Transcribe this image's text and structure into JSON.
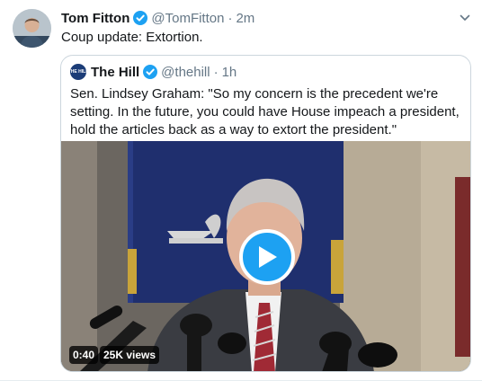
{
  "tweet": {
    "author_name": "Tom Fitton",
    "author_handle": "@TomFitton",
    "separator": "·",
    "timestamp": "2m",
    "text": "Coup update: Extortion."
  },
  "quoted_tweet": {
    "avatar_text": "THE HILL",
    "author_name": "The Hill",
    "author_handle": "@thehill",
    "separator": "·",
    "timestamp": "1h",
    "text": "Sen. Lindsey Graham: \"So my concern is the precedent we're setting. In the future, you could have House impeach a president, hold the articles back as a way to extort the president.\"",
    "video": {
      "duration": "0:40",
      "views": "25K views"
    }
  },
  "icons": {
    "verified": "verified-badge-icon",
    "caret": "chevron-down-icon",
    "play": "play-icon"
  },
  "colors": {
    "accent": "#1da1f2",
    "muted_text": "#657786",
    "border": "#ccd6dd"
  }
}
